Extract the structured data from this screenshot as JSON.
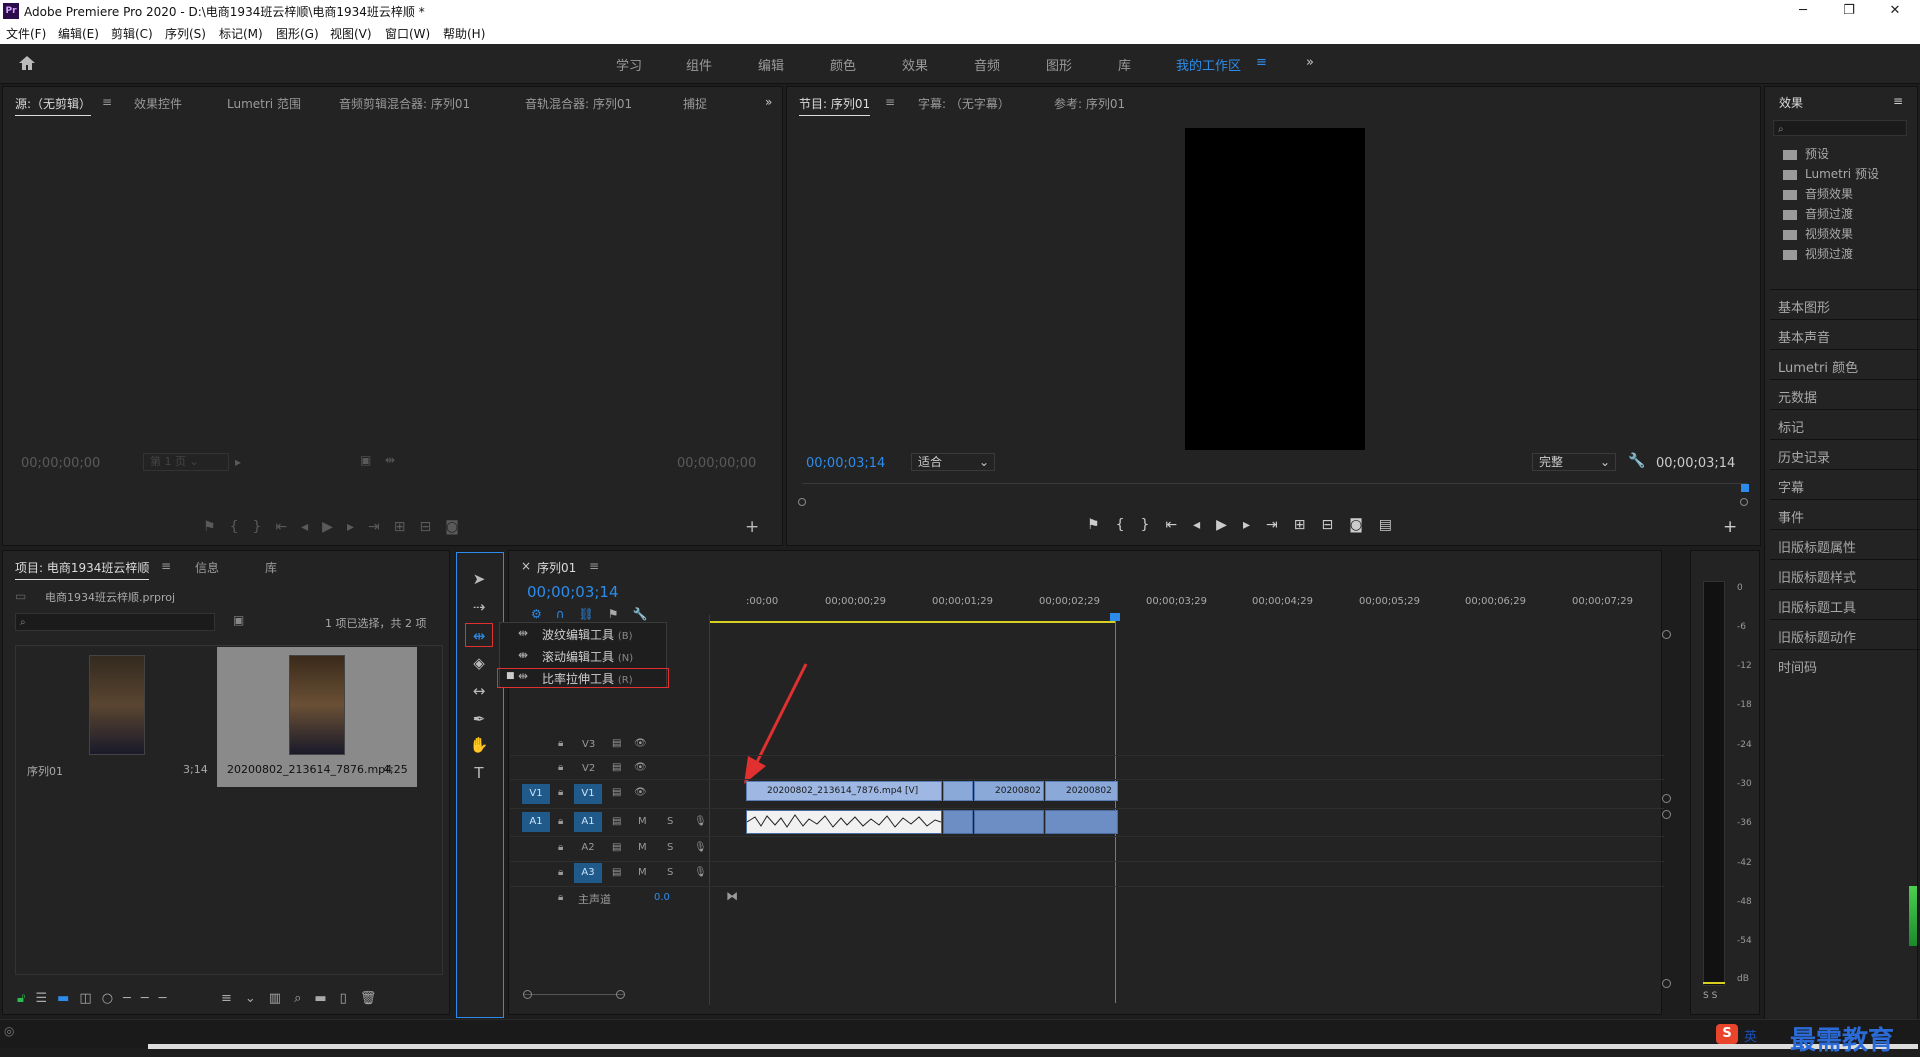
{
  "window": {
    "title": "Adobe Premiere Pro 2020 - D:\\电商1934班云梓顺\\电商1934班云梓顺 *",
    "logo_text": "Pr",
    "min": "─",
    "max": "❐",
    "close": "✕"
  },
  "menu": [
    "文件(F)",
    "编辑(E)",
    "剪辑(C)",
    "序列(S)",
    "标记(M)",
    "图形(G)",
    "视图(V)",
    "窗口(W)",
    "帮助(H)"
  ],
  "workspaces": [
    "学习",
    "组件",
    "编辑",
    "颜色",
    "效果",
    "音频",
    "图形",
    "库",
    "我的工作区"
  ],
  "workspace_active_menu": "≡",
  "more": "»",
  "source": {
    "tabs": [
      "源:（无剪辑）",
      "效果控件",
      "Lumetri 范围",
      "音频剪辑混合器: 序列01",
      "音轨混合器: 序列01",
      "捕捉"
    ],
    "tab_menu": "≡",
    "more": "»",
    "tc_left": "00;00;00;00",
    "page": "第 1 页",
    "tc_right": "00;00;00;00",
    "add": "+"
  },
  "program": {
    "tabs": [
      "节目: 序列01",
      "字幕: （无字幕）",
      "参考: 序列01"
    ],
    "tab_menu": "≡",
    "tc_left": "00;00;03;14",
    "fit": "适合",
    "quality": "完整",
    "tc_right": "00;00;03;14",
    "add": "+"
  },
  "project": {
    "tabs": [
      "项目: 电商1934班云梓顺",
      "信息",
      "库"
    ],
    "tab_menu": "≡",
    "file": "电商1934班云梓顺.prproj",
    "selection": "1 项已选择，共 2 项",
    "items": [
      {
        "name": "序列01",
        "duration": "3;14"
      },
      {
        "name": "20200802_213614_7876.mp4",
        "duration": "4;25"
      }
    ]
  },
  "timeline": {
    "tab": "序列01",
    "close": "×",
    "tab_menu": "≡",
    "timecode": "00;00;03;14",
    "ruler": [
      ":00;00",
      "00;00;00;29",
      "00;00;01;29",
      "00;00;02;29",
      "00;00;03;29",
      "00;00;04;29",
      "00;00;05;29",
      "00;00;06;29",
      "00;00;07;29"
    ],
    "tracks": [
      {
        "id": "V3"
      },
      {
        "id": "V2"
      },
      {
        "id": "V1",
        "src": "V1"
      },
      {
        "id": "A1",
        "src": "A1"
      },
      {
        "id": "A2"
      },
      {
        "id": "A3"
      }
    ],
    "master": {
      "label": "主声道",
      "value": "0.0"
    },
    "clips": [
      {
        "label": "20200802_213614_7876.mp4 [V]"
      },
      {
        "label": ""
      },
      {
        "label": "20200802"
      },
      {
        "label": "20200802"
      }
    ],
    "mute": "M",
    "solo": "S"
  },
  "tool_menu": {
    "items": [
      {
        "label": "波纹编辑工具",
        "key": "(B)"
      },
      {
        "label": "滚动编辑工具",
        "key": "(N)"
      },
      {
        "label": "比率拉伸工具",
        "key": "(R)"
      }
    ]
  },
  "effects": {
    "title": "效果",
    "menu": "≡",
    "folders": [
      "预设",
      "Lumetri 预设",
      "音频效果",
      "音频过渡",
      "视频效果",
      "视频过渡"
    ],
    "panels": [
      "基本图形",
      "基本声音",
      "Lumetri 颜色",
      "元数据",
      "标记",
      "历史记录",
      "字幕",
      "事件",
      "旧版标题属性",
      "旧版标题样式",
      "旧版标题工具",
      "旧版标题动作",
      "时间码"
    ]
  },
  "meter": {
    "scale": [
      "0",
      "-6",
      "-12",
      "-18",
      "-24",
      "-30",
      "-36",
      "-42",
      "-48",
      "-54",
      "dB"
    ],
    "solo": "S S"
  },
  "ime": {
    "lang": "英"
  },
  "watermark": "最需教育",
  "colors": {
    "accent": "#2d8ceb",
    "highlight_red": "#e03030",
    "clip_video": "#8aa8d8",
    "clip_audio": "#6d8ec4"
  }
}
